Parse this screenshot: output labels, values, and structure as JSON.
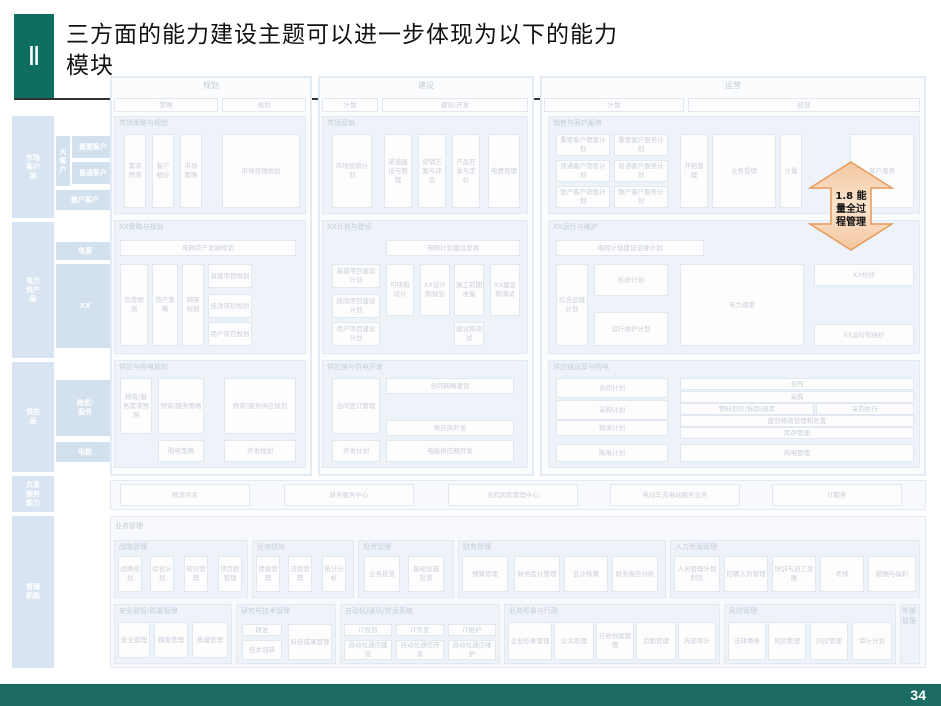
{
  "title": {
    "marker": "Ⅱ",
    "line1": "三方面的能力建设主题可以进一步体现为以下的能力",
    "line2": "模块"
  },
  "footer": {
    "page": "34"
  },
  "callout": {
    "text1": "1.8 能",
    "text2": "量全过",
    "text3": "程管理"
  },
  "columns": {
    "plan": "规划",
    "build": "建设",
    "ops": "运营"
  },
  "subheads": {
    "strategy": "策略",
    "planning": "规划",
    "plan": "计划",
    "construct": "建设/开发",
    "plan2": "计划",
    "op": "经营"
  },
  "rows": {
    "market": "市场\n客户\n层",
    "power": "电力\n资产\n层",
    "supply": "供应\n层",
    "shared": "共享\n服务\n能力",
    "mgmt": "管理\n职能"
  },
  "leftlabels": {
    "big": "大\n客\n户",
    "kxk": "重要客户",
    "zzk": "普通客户",
    "sy": "散户客户",
    "dy": "电源",
    "xx": "XX",
    "sp": "物资/\n服务",
    "dn": "电能"
  },
  "panes": {
    "market1": "市场策略与规划",
    "market2": "市场营销",
    "market3": "销售与客户服务",
    "power1": "XX策略与规划",
    "power2": "XX计划与建设",
    "power3": "XX运行与维护",
    "supply1": "供应与购电规划",
    "supply2": "供应链与供电开发",
    "supply3": "供应链运营与购电",
    "mgmt": "业务管理"
  },
  "market_boxes": [
    "需求预测",
    "客户细分",
    "市场策略",
    "市场营销规划",
    "市场营销计划",
    "渠道建设与管理",
    "营销方案与评估",
    "产品开发与定价",
    "电费管理",
    "重要客户销售计划",
    "重要客户服务计划",
    "普通客户销售计划",
    "普通客户服务计划",
    "散户客户销售计划",
    "散户客户服务计划",
    "开拓管理",
    "业务受理",
    "计量",
    "客户服务"
  ],
  "power_boxes": [
    "电网资产发展规划",
    "负荷预测",
    "资产策略",
    "网架规划",
    "基建项目规划",
    "技改项目规划",
    "用户项目规划",
    "电网计划建设发展",
    "基建项目建设计划",
    "技改项目建设计划",
    "用户项目建设计划",
    "XX设计和规划",
    "XX建设和调试",
    "可研和设计",
    "施工前期准备",
    "建设和调试",
    "电网计划建设运维计划",
    "检修计划",
    "运行维护计划",
    "综合运维计划",
    "电力调度",
    "XX检修",
    "XX运行和维护"
  ],
  "supply_boxes": [
    "物资/服务需求预测",
    "物资/服务策略",
    "物资/服务供应规划",
    "购电策略",
    "开发规划",
    "合同签订管理",
    "合同网络建设",
    "供应商开发",
    "开发计划",
    "电能供应网开发",
    "合同计划",
    "采购计划",
    "物流计划",
    "购电计划",
    "合同",
    "采购",
    "物料到货/拆卸/退库",
    "采购执行",
    "废旧物资管理和处置",
    "库存管理",
    "购电管理"
  ],
  "shared": [
    "物流共享",
    "财务服务中心",
    "合同风险管理中心",
    "电动车充电站服务业务",
    "IT服务"
  ],
  "mgmt_groups": [
    "战略管理",
    "业务绩效",
    "投资管理",
    "财务管理",
    "人力资源管理",
    "安全监管/质量管理",
    "研究与技术管理",
    "自动化/通讯/信息系统",
    "业务形象与行政",
    "风险管理",
    "外部管理"
  ],
  "mgmt_boxes": [
    "战略规划",
    "综合计划",
    "知识管理",
    "项目群管理",
    "绩效管理",
    "流程管理",
    "统计分析",
    "业务投资",
    "基础设施投资",
    "预算管理",
    "财务会计管理",
    "会计核算",
    "财务报告分析",
    "人员管理计划制定",
    "招聘人员管理",
    "培训与员工发展",
    "考核",
    "薪酬与福利",
    "安全管理",
    "稽查管理",
    "质量管理",
    "研发",
    "技术创新",
    "科技成果管理",
    "IT规划",
    "IT开发",
    "IT维护",
    "自动化通信建设",
    "自动化通信开发",
    "自动化通信维护",
    "企业形象管理",
    "公关管理",
    "行政档案管理",
    "后勤管理",
    "内部审计",
    "法律事务",
    "风险管理",
    "内控管理",
    "审计计划",
    "外部管理"
  ]
}
